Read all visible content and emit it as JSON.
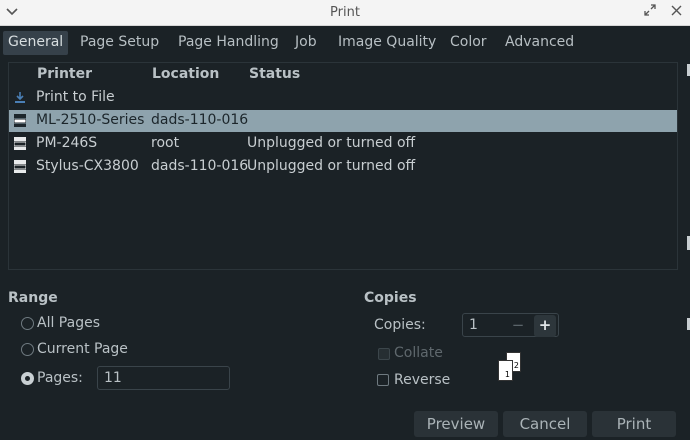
{
  "window": {
    "title": "Print"
  },
  "tabs": [
    {
      "label": "General",
      "active": true
    },
    {
      "label": "Page Setup",
      "active": false
    },
    {
      "label": "Page Handling",
      "active": false
    },
    {
      "label": "Job",
      "active": false
    },
    {
      "label": "Image Quality",
      "active": false
    },
    {
      "label": "Color",
      "active": false
    },
    {
      "label": "Advanced",
      "active": false
    }
  ],
  "printers": {
    "headers": [
      "Printer",
      "Location",
      "Status"
    ],
    "rows": [
      {
        "icon": "download-icon",
        "name": "Print to File",
        "location": "",
        "status": "",
        "selected": false
      },
      {
        "icon": "printer-icon",
        "name": "ML-2510-Series",
        "location": "dads-110-016",
        "status": "",
        "selected": true
      },
      {
        "icon": "printer-icon",
        "name": "PM-246S",
        "location": "root",
        "status": "Unplugged or turned off",
        "selected": false
      },
      {
        "icon": "printer-icon",
        "name": "Stylus-CX3800",
        "location": "dads-110-016",
        "status": "Unplugged or turned off",
        "selected": false
      }
    ]
  },
  "range": {
    "title": "Range",
    "all_pages": "All Pages",
    "current_page": "Current Page",
    "pages": "Pages:",
    "pages_value": "11",
    "selected": "pages"
  },
  "copies": {
    "title": "Copies",
    "label": "Copies:",
    "value": "1",
    "minus": "−",
    "plus": "+",
    "collate": "Collate",
    "collate_enabled": false,
    "reverse": "Reverse",
    "reverse_checked": false,
    "preview_pages": [
      "1",
      "2"
    ]
  },
  "buttons": {
    "preview": "Preview",
    "cancel": "Cancel",
    "print": "Print"
  },
  "colors": {
    "background": "#1b2226",
    "selection": "#8ea3ad",
    "tab_active": "#36414a"
  }
}
